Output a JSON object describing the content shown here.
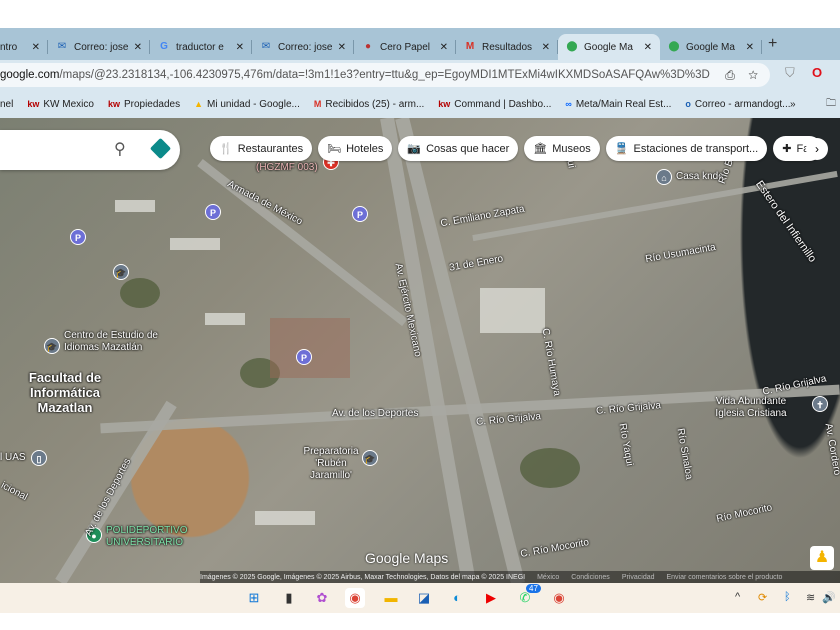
{
  "tabs": [
    {
      "label": "ntro",
      "icon": "app-icon"
    },
    {
      "label": "Correo: jose",
      "icon": "outlook-icon"
    },
    {
      "label": "traductor e",
      "icon": "google-icon"
    },
    {
      "label": "Correo: jose",
      "icon": "outlook-icon"
    },
    {
      "label": "Cero Papel",
      "icon": "cero-papel-icon"
    },
    {
      "label": "Resultados",
      "icon": "gmail-icon"
    },
    {
      "label": "Google Ma",
      "icon": "maps-icon",
      "active": true
    },
    {
      "label": "Google Ma",
      "icon": "maps-icon"
    }
  ],
  "new_tab": "+",
  "address": {
    "domain": "google.com",
    "path": "/maps/@23.2318134,-106.4230975,476m/data=!3m1!1e3?entry=ttu&g_ep=EgoyMDI1MTExMi4wIKXMDSoASAFQAw%3D%3D"
  },
  "bookmarks": [
    {
      "label": "nel",
      "icon": ""
    },
    {
      "label": "KW Mexico",
      "icon": "kw"
    },
    {
      "label": "Propiedades",
      "icon": "kw"
    },
    {
      "label": "Mi unidad - Google...",
      "icon": "▲"
    },
    {
      "label": "Recibidos (25) - arm...",
      "icon": "M"
    },
    {
      "label": "Command | Dashbo...",
      "icon": "kw"
    },
    {
      "label": "Meta/Main Real Est...",
      "icon": "∞"
    },
    {
      "label": "Correo - armandogt...",
      "icon": "o"
    }
  ],
  "bookmarks_more": "»",
  "chips": [
    {
      "label": "Restaurantes",
      "icon": "🍴"
    },
    {
      "label": "Hoteles",
      "icon": "🛏"
    },
    {
      "label": "Cosas que hacer",
      "icon": "📷"
    },
    {
      "label": "Museos",
      "icon": "🏛"
    },
    {
      "label": "Estaciones de transport...",
      "icon": "🚆"
    },
    {
      "label": "Far",
      "icon": "✚"
    }
  ],
  "map_labels": {
    "armada": "Armada de México",
    "hgzmf": "(HGZMF 003)",
    "zapata": "C. Emiliano Zapata",
    "casa": "Casa knde",
    "estero": "Estero del Infiernillo",
    "enero": "31 de Enero",
    "usumacinta": "Río Usumacinta",
    "balsas": "Río Balsas",
    "ejercito": "Av. Ejército Mexicano",
    "humaya": "C. Río Humaya",
    "centro": "Centro de Estudio de Idiomas Mazatlán",
    "facultad": "Facultad de Informática Mazatlan",
    "deportes1": "Av. de los Deportes",
    "grijalva1": "C. Río Grijalva",
    "grijalva2": "C. Río Grijalva",
    "grijalva3": "C. Río Grijalva",
    "vida": "Vida Abundante Iglesia Cristiana",
    "yaqui": "Río Yaqui",
    "sinaloa": "Río Sinaloa",
    "prepa": "Preparatoria 'Rubén Jaramillo'",
    "deportes2": "Av. de los Deportes",
    "uas": "l UAS",
    "poli": "POLIDEPORTIVO UNIVERSITARIO",
    "mocorito1": "Río Mocorito",
    "mocorito2": "C. Río Mocorito",
    "nacional": "icional",
    "yaqui2": "Yaqui",
    "cordero": "Av. Cordero"
  },
  "logo": "Google Maps",
  "attribution": {
    "imagery": "Imágenes © 2025 Google, Imágenes © 2025 Airbus, Maxar Technologies, Datos del mapa © 2025 INEGI",
    "country": "México",
    "terms": "Condiciones",
    "privacy": "Privacidad",
    "feedback": "Enviar comentarios sobre el producto"
  },
  "taskbar": {
    "whatsapp_badge": "47"
  }
}
